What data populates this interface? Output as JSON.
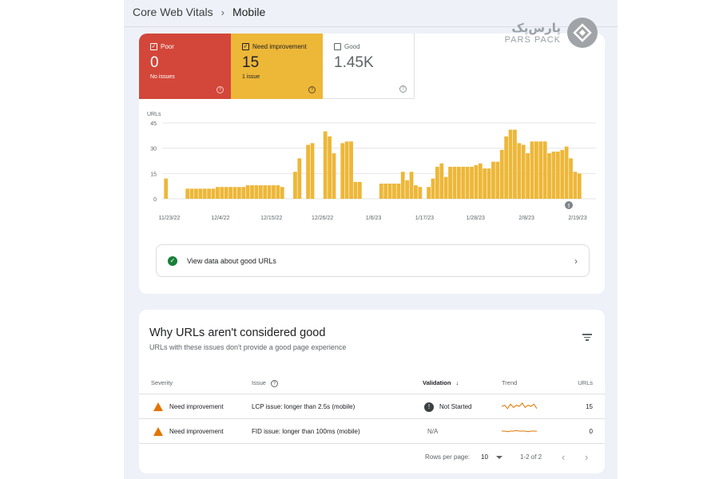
{
  "breadcrumb": {
    "parent": "Core Web Vitals",
    "separator": "›",
    "current": "Mobile"
  },
  "logo": {
    "fa": "پارس‌پک",
    "en": "PARS PACK"
  },
  "tiles": [
    {
      "checked": "✓",
      "label": "Poor",
      "value": "0",
      "sub": "No issues",
      "help": "?"
    },
    {
      "checked": "✓",
      "label": "Need improvement",
      "value": "15",
      "sub": "1 issue",
      "help": "?"
    },
    {
      "checked": "",
      "label": "Good",
      "value": "1.45K",
      "sub": "",
      "help": "?"
    }
  ],
  "chart_data": {
    "type": "bar",
    "ylabel": "URLs",
    "ylim": [
      0,
      45
    ],
    "yticks": [
      0,
      15,
      30,
      45
    ],
    "xticks": [
      "11/23/22",
      "12/4/22",
      "12/15/22",
      "12/26/22",
      "1/6/23",
      "1/17/23",
      "1/28/23",
      "2/8/23",
      "2/19/23"
    ],
    "color": "#edb738",
    "annotation": "!",
    "values": [
      12,
      0,
      0,
      0,
      0,
      6,
      6,
      6,
      6,
      6,
      6,
      6,
      7,
      7,
      7,
      7,
      7,
      7,
      7,
      8,
      8,
      8,
      8,
      8,
      8,
      8,
      8,
      7,
      0,
      0,
      16,
      24,
      0,
      32,
      33,
      0,
      0,
      40,
      37,
      27,
      0,
      33,
      34,
      34,
      10,
      10,
      0,
      0,
      0,
      0,
      9,
      9,
      9,
      9,
      9,
      16,
      11,
      16,
      8,
      7,
      0,
      7,
      12,
      19,
      21,
      13,
      19,
      19,
      19,
      19,
      19,
      19,
      20,
      21,
      18,
      18,
      22,
      22,
      29,
      37,
      41,
      41,
      33,
      32,
      27,
      34,
      34,
      34,
      34,
      27,
      28,
      28,
      29,
      31,
      24,
      16,
      15
    ]
  },
  "good_link": {
    "label": "View data about good URLs",
    "check": "✓",
    "chevron": "›"
  },
  "issues": {
    "title": "Why URLs aren't considered good",
    "subtitle": "URLs with these issues don't provide a good page experience",
    "columns": {
      "severity": "Severity",
      "issue": "Issue",
      "issue_help": "?",
      "validation": "Validation",
      "sort_icon": "↓",
      "trend": "Trend",
      "urls": "URLs"
    },
    "rows": [
      {
        "severity": "Need improvement",
        "issue": "LCP issue: longer than 2.5s (mobile)",
        "validation": "Not Started",
        "validation_icon": "!",
        "urls": "15",
        "trend": [
          0.5,
          0.6,
          0.3,
          0.7,
          0.4,
          0.6,
          0.5,
          0.8,
          0.4,
          0.6,
          0.5,
          0.7,
          0.3
        ]
      },
      {
        "severity": "Need improvement",
        "issue": "FID issue: longer than 100ms (mobile)",
        "validation": "N/A",
        "validation_icon": "",
        "urls": "0",
        "trend": [
          0.5,
          0.5,
          0.45,
          0.5,
          0.5,
          0.55,
          0.5,
          0.5,
          0.5,
          0.45,
          0.5,
          0.5,
          0.5
        ]
      }
    ]
  },
  "pagination": {
    "rows_label": "Rows per page:",
    "rows_value": "10",
    "range": "1-2 of 2",
    "prev": "‹",
    "next": "›"
  }
}
